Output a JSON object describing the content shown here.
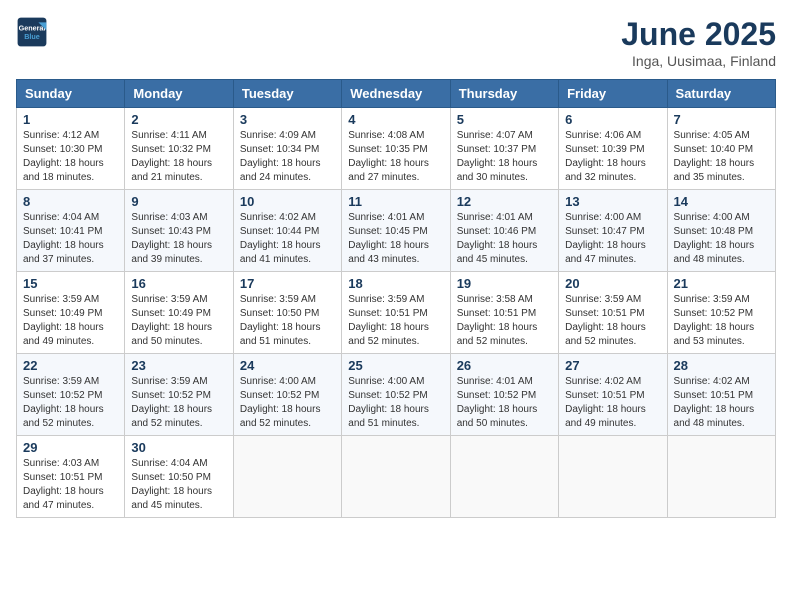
{
  "header": {
    "logo_line1": "General",
    "logo_line2": "Blue",
    "title": "June 2025",
    "subtitle": "Inga, Uusimaa, Finland"
  },
  "calendar": {
    "headers": [
      "Sunday",
      "Monday",
      "Tuesday",
      "Wednesday",
      "Thursday",
      "Friday",
      "Saturday"
    ],
    "weeks": [
      [
        null,
        {
          "day": "2",
          "sunrise": "Sunrise: 4:11 AM",
          "sunset": "Sunset: 10:32 PM",
          "daylight": "Daylight: 18 hours and 21 minutes."
        },
        {
          "day": "3",
          "sunrise": "Sunrise: 4:09 AM",
          "sunset": "Sunset: 10:34 PM",
          "daylight": "Daylight: 18 hours and 24 minutes."
        },
        {
          "day": "4",
          "sunrise": "Sunrise: 4:08 AM",
          "sunset": "Sunset: 10:35 PM",
          "daylight": "Daylight: 18 hours and 27 minutes."
        },
        {
          "day": "5",
          "sunrise": "Sunrise: 4:07 AM",
          "sunset": "Sunset: 10:37 PM",
          "daylight": "Daylight: 18 hours and 30 minutes."
        },
        {
          "day": "6",
          "sunrise": "Sunrise: 4:06 AM",
          "sunset": "Sunset: 10:39 PM",
          "daylight": "Daylight: 18 hours and 32 minutes."
        },
        {
          "day": "7",
          "sunrise": "Sunrise: 4:05 AM",
          "sunset": "Sunset: 10:40 PM",
          "daylight": "Daylight: 18 hours and 35 minutes."
        }
      ],
      [
        {
          "day": "1",
          "sunrise": "Sunrise: 4:12 AM",
          "sunset": "Sunset: 10:30 PM",
          "daylight": "Daylight: 18 hours and 18 minutes."
        },
        {
          "day": "9",
          "sunrise": "Sunrise: 4:03 AM",
          "sunset": "Sunset: 10:43 PM",
          "daylight": "Daylight: 18 hours and 39 minutes."
        },
        {
          "day": "10",
          "sunrise": "Sunrise: 4:02 AM",
          "sunset": "Sunset: 10:44 PM",
          "daylight": "Daylight: 18 hours and 41 minutes."
        },
        {
          "day": "11",
          "sunrise": "Sunrise: 4:01 AM",
          "sunset": "Sunset: 10:45 PM",
          "daylight": "Daylight: 18 hours and 43 minutes."
        },
        {
          "day": "12",
          "sunrise": "Sunrise: 4:01 AM",
          "sunset": "Sunset: 10:46 PM",
          "daylight": "Daylight: 18 hours and 45 minutes."
        },
        {
          "day": "13",
          "sunrise": "Sunrise: 4:00 AM",
          "sunset": "Sunset: 10:47 PM",
          "daylight": "Daylight: 18 hours and 47 minutes."
        },
        {
          "day": "14",
          "sunrise": "Sunrise: 4:00 AM",
          "sunset": "Sunset: 10:48 PM",
          "daylight": "Daylight: 18 hours and 48 minutes."
        }
      ],
      [
        {
          "day": "8",
          "sunrise": "Sunrise: 4:04 AM",
          "sunset": "Sunset: 10:41 PM",
          "daylight": "Daylight: 18 hours and 37 minutes."
        },
        {
          "day": "16",
          "sunrise": "Sunrise: 3:59 AM",
          "sunset": "Sunset: 10:49 PM",
          "daylight": "Daylight: 18 hours and 50 minutes."
        },
        {
          "day": "17",
          "sunrise": "Sunrise: 3:59 AM",
          "sunset": "Sunset: 10:50 PM",
          "daylight": "Daylight: 18 hours and 51 minutes."
        },
        {
          "day": "18",
          "sunrise": "Sunrise: 3:59 AM",
          "sunset": "Sunset: 10:51 PM",
          "daylight": "Daylight: 18 hours and 52 minutes."
        },
        {
          "day": "19",
          "sunrise": "Sunrise: 3:58 AM",
          "sunset": "Sunset: 10:51 PM",
          "daylight": "Daylight: 18 hours and 52 minutes."
        },
        {
          "day": "20",
          "sunrise": "Sunrise: 3:59 AM",
          "sunset": "Sunset: 10:51 PM",
          "daylight": "Daylight: 18 hours and 52 minutes."
        },
        {
          "day": "21",
          "sunrise": "Sunrise: 3:59 AM",
          "sunset": "Sunset: 10:52 PM",
          "daylight": "Daylight: 18 hours and 53 minutes."
        }
      ],
      [
        {
          "day": "15",
          "sunrise": "Sunrise: 3:59 AM",
          "sunset": "Sunset: 10:49 PM",
          "daylight": "Daylight: 18 hours and 49 minutes."
        },
        {
          "day": "23",
          "sunrise": "Sunrise: 3:59 AM",
          "sunset": "Sunset: 10:52 PM",
          "daylight": "Daylight: 18 hours and 52 minutes."
        },
        {
          "day": "24",
          "sunrise": "Sunrise: 4:00 AM",
          "sunset": "Sunset: 10:52 PM",
          "daylight": "Daylight: 18 hours and 52 minutes."
        },
        {
          "day": "25",
          "sunrise": "Sunrise: 4:00 AM",
          "sunset": "Sunset: 10:52 PM",
          "daylight": "Daylight: 18 hours and 51 minutes."
        },
        {
          "day": "26",
          "sunrise": "Sunrise: 4:01 AM",
          "sunset": "Sunset: 10:52 PM",
          "daylight": "Daylight: 18 hours and 50 minutes."
        },
        {
          "day": "27",
          "sunrise": "Sunrise: 4:02 AM",
          "sunset": "Sunset: 10:51 PM",
          "daylight": "Daylight: 18 hours and 49 minutes."
        },
        {
          "day": "28",
          "sunrise": "Sunrise: 4:02 AM",
          "sunset": "Sunset: 10:51 PM",
          "daylight": "Daylight: 18 hours and 48 minutes."
        }
      ],
      [
        {
          "day": "22",
          "sunrise": "Sunrise: 3:59 AM",
          "sunset": "Sunset: 10:52 PM",
          "daylight": "Daylight: 18 hours and 52 minutes."
        },
        {
          "day": "30",
          "sunrise": "Sunrise: 4:04 AM",
          "sunset": "Sunset: 10:50 PM",
          "daylight": "Daylight: 18 hours and 45 minutes."
        },
        null,
        null,
        null,
        null,
        null
      ],
      [
        {
          "day": "29",
          "sunrise": "Sunrise: 4:03 AM",
          "sunset": "Sunset: 10:51 PM",
          "daylight": "Daylight: 18 hours and 47 minutes."
        },
        null,
        null,
        null,
        null,
        null,
        null
      ]
    ]
  }
}
